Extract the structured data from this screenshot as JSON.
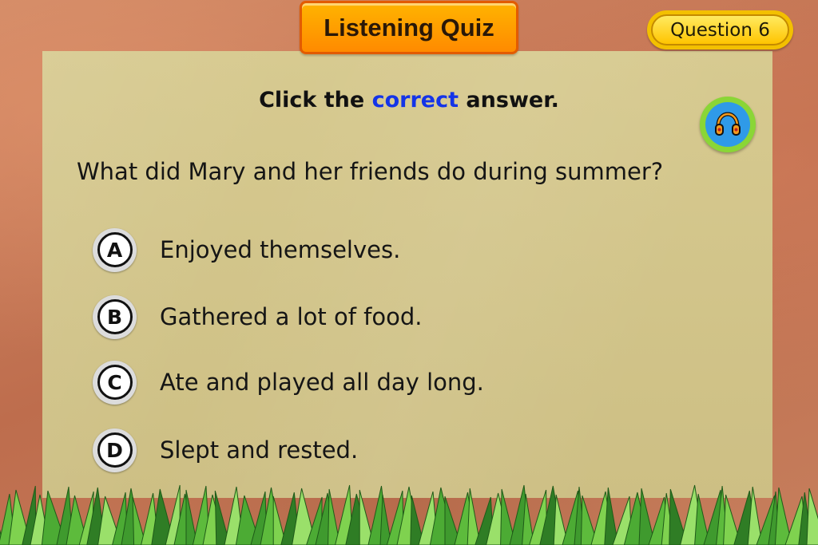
{
  "header": {
    "title": "Listening Quiz",
    "question_badge": "Question 6"
  },
  "instruction": {
    "before": "Click the ",
    "highlight": "correct",
    "after": " answer."
  },
  "question": "What did Mary and her friends do during summer?",
  "options": [
    {
      "letter": "A",
      "text": "Enjoyed themselves."
    },
    {
      "letter": "B",
      "text": "Gathered a lot of food."
    },
    {
      "letter": "C",
      "text": "Ate and played all day long."
    },
    {
      "letter": "D",
      "text": "Slept and rested."
    }
  ],
  "icons": {
    "audio": "headphones-icon"
  },
  "colors": {
    "highlight": "#1434e8",
    "title_tab": "#ff9a00",
    "badge": "#ffd21e",
    "audio_ring": "#8ad636",
    "audio_disc": "#2f9ae8",
    "panel": "#d3c68b"
  }
}
